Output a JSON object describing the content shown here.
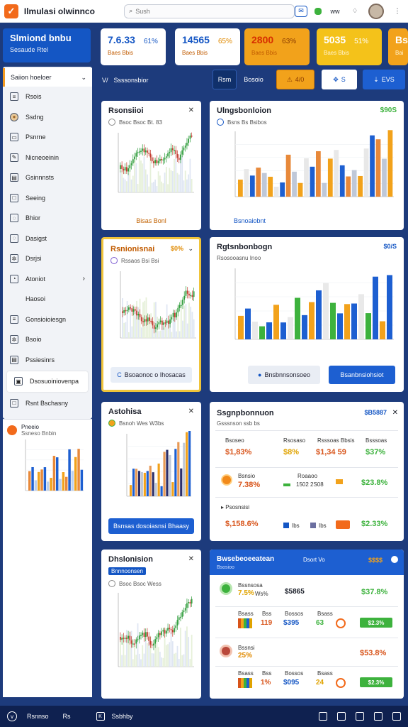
{
  "topbar": {
    "app_title": "Ilmulasi olwinnco",
    "search_placeholder": "Sush",
    "icon_labels": [
      "w",
      "w",
      "ww",
      "w"
    ]
  },
  "sidebar": {
    "brand_title": "Slmiond bnbu",
    "brand_sub": "Sesaude Rtel",
    "section_label": "Saiion hoeloer",
    "items": [
      {
        "label": "Rsois",
        "icon": "list-icon"
      },
      {
        "label": "Ssdng",
        "icon": "coin-icon"
      },
      {
        "label": "Psnrne",
        "icon": "file-icon"
      },
      {
        "label": "Nicneoeinin",
        "icon": "edit-icon"
      },
      {
        "label": "Gsinnnsts",
        "icon": "doc-icon"
      },
      {
        "label": "Seeing",
        "icon": "square-icon"
      },
      {
        "label": "Bhior",
        "icon": "chat-icon"
      },
      {
        "label": "Dasigst",
        "icon": "chat-icon"
      },
      {
        "label": "Dsrjsi",
        "icon": "gear-icon"
      },
      {
        "label": "Atoniot",
        "icon": "clock-icon"
      },
      {
        "label": "Haosoi",
        "icon": "none"
      },
      {
        "label": "Gonsioioiesgn",
        "icon": "list-icon"
      },
      {
        "label": "Bsoio",
        "icon": "gear-icon"
      },
      {
        "label": "Pssiesinrs",
        "icon": "doc-icon"
      },
      {
        "label": "Dsosuoiniovenpa",
        "icon": "box-icon"
      },
      {
        "label": "Rsnt Bschasny",
        "icon": "square-icon"
      }
    ],
    "mini_chart": {
      "title": "Pneeio",
      "sub": "Ssneso Bnbin",
      "x_labels": [
        "Bslas",
        "Ghst",
        "Tss",
        "Bssg"
      ]
    }
  },
  "kpis": [
    {
      "value": "7.6.33",
      "delta": "61%",
      "sub": "Baes Bbis",
      "bg": "#ffffff",
      "color": "#1456c4",
      "delta_color": "#1456c4"
    },
    {
      "value": "14565",
      "delta": "65%",
      "sub": "Baes Bbis",
      "bg": "#ffffff",
      "color": "#1456c4",
      "delta_color": "#e08a00"
    },
    {
      "value": "2800",
      "delta": "63%",
      "sub": "Baes Bbis",
      "bg": "#f2a21b",
      "color": "#d72f00",
      "delta_color": "#8a3b00"
    },
    {
      "value": "5035",
      "delta": "51%",
      "sub": "Baes Bbis",
      "bg": "#f4c21a",
      "color": "#ffffff",
      "delta_color": "#ffffff"
    },
    {
      "value": "Bs",
      "delta": "",
      "sub": "Bai",
      "bg": "#f2a21b",
      "color": "#ffffff",
      "delta_color": "#ffffff"
    }
  ],
  "toolbar": {
    "label": "Ssssonsbior",
    "btn_item": "Rsm",
    "btn_desc": "Bosoio",
    "btn_warn": "4/0",
    "btn_ws": "S",
    "btn_blue": "EVS"
  },
  "cards": {
    "c1": {
      "title": "Rsonsiioi",
      "sub": "Bsoc Bsoc Bt. 83",
      "link": "Bisas Bonl"
    },
    "c2": {
      "title": "Ulngsbonloion",
      "sub": "Bsns Bs Bsibos",
      "value": "$90S",
      "link": "Bsnoaiobnt"
    },
    "c3": {
      "title": "Rsnionisnai",
      "value": "$0%",
      "sub": "Rssaos Bsi Bsi",
      "button": "Bsoaonoc o Ihosacas"
    },
    "c4": {
      "title": "Rgtsnbonbogn",
      "value": "$0/S",
      "sub": "Rsosooasnu Inoo",
      "footer": "Bssnso Sisib",
      "btn_secondary": "Bnsbnnsonsoeo",
      "btn_primary": "Bsanbnsiohsiot"
    },
    "c5": {
      "title": "Astohisa",
      "sub": "Bsnoh Wes W3bs",
      "button": "Bsnsas dosoiasnsi Bhaasy"
    },
    "c6": {
      "title": "Ssgnpbonnuon",
      "value": "$B5887",
      "sub": "Gsssnson ssb bs"
    },
    "c7": {
      "title": "Dhslonision",
      "badge": "Bnnnoonsen",
      "sub": "Bsoc Bsoc Wess"
    },
    "c8": {
      "title": "Bwsebeoeeatean",
      "sub": "Bsosioo",
      "head_right": "Dsort  Vo",
      "head_value": "$$$$"
    }
  },
  "table1": {
    "header_labels": [
      "Bsoseo",
      "Rsosaso",
      "Rsssoas Bbsis",
      "Bsssoas"
    ],
    "row1": [
      "$1,83%",
      "$8%",
      "$1,34 59",
      "$37%"
    ],
    "row2_label": "Bsnsio",
    "row2_values": [
      "7.38%",
      "1502 2S08",
      "$23.8%"
    ],
    "row2_sublabel": "Roaaoo",
    "row3_label": "Psosnsisi",
    "row3_values": [
      "$,158.6%",
      "$2.33%"
    ],
    "row3_tags": [
      "Ibs",
      "Ibs"
    ]
  },
  "table2": {
    "row1": [
      "7.5%",
      "Ws%",
      "$5865",
      "$37.8%"
    ],
    "row1_label": "Bssnsosa",
    "row2_headers": [
      "Bsass",
      "Bss",
      "Bossos",
      "Bsass"
    ],
    "row2": [
      "119",
      "$395",
      "63",
      "$2.3%"
    ],
    "row3_label": "Bssnsi",
    "row3": [
      "25%",
      "$53.8%"
    ],
    "row4_headers": [
      "Bsass",
      "Bss",
      "Bossos",
      "Bsass"
    ],
    "row4": [
      "1%",
      "$095",
      "24",
      "$2.3%"
    ]
  },
  "bottombar": {
    "left": "Rsnnso",
    "left2": "Rs",
    "mid": "Ssbhby"
  },
  "colors": {
    "brand": "#1456c4",
    "accent": "#f26a1b",
    "navy": "#1d3b7c",
    "orange": "#f2a21b",
    "green": "#3db23d"
  }
}
